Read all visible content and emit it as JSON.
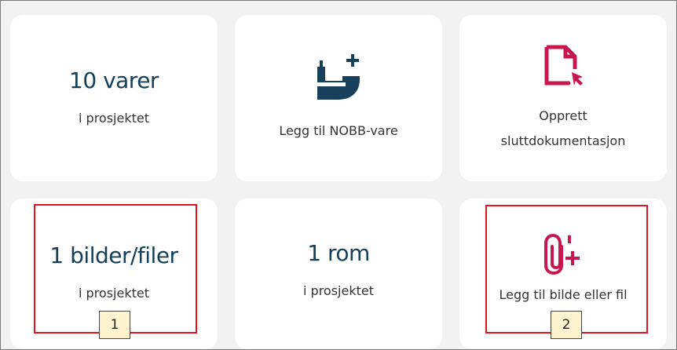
{
  "stats": {
    "items": {
      "value": "10 varer",
      "caption": "i prosjektet"
    },
    "files": {
      "value": "1 bilder/filer",
      "caption": "i prosjektet"
    },
    "rooms": {
      "value": "1 rom",
      "caption": "i prosjektet"
    }
  },
  "actions": {
    "add_nobb": {
      "label": "Legg til NOBB-vare",
      "icon": "add-nobb-product-icon"
    },
    "create_docs": {
      "line1": "Opprett",
      "line2": "sluttdokumentasjon",
      "icon": "document-cursor-icon"
    },
    "add_file": {
      "label": "Legg til bilde eller fil",
      "icon": "paperclip-add-icon"
    }
  },
  "annotations": {
    "marker_1": "1",
    "marker_2": "2"
  },
  "colors": {
    "stat_text": "#14405a",
    "nobb_icon": "#17405a",
    "action_icon": "#c8174f",
    "highlight": "#e0141e",
    "marker_bg": "#fdf3cf"
  }
}
